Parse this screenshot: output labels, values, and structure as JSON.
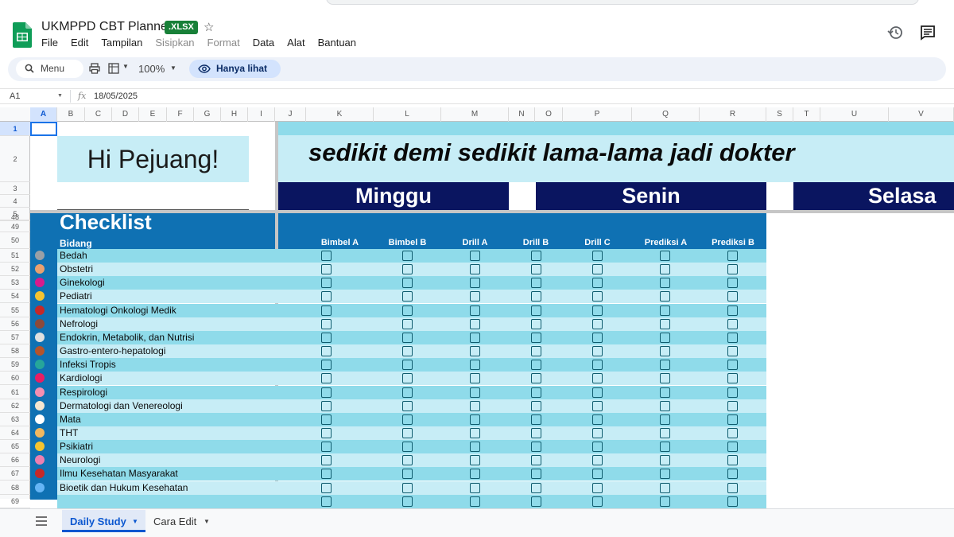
{
  "app": {
    "title": "UKMPPD CBT Planner",
    "badge": ".XLSX",
    "menu": [
      "File",
      "Edit",
      "Tampilan",
      "Sisipkan",
      "Format",
      "Data",
      "Alat",
      "Bantuan"
    ],
    "disabled_menu": [
      "Sisipkan",
      "Format"
    ]
  },
  "toolbar": {
    "search_label": "Menu",
    "zoom": "100%",
    "view_only_label": "Hanya lihat"
  },
  "formula": {
    "cell": "A1",
    "fx": "fx",
    "value": "18/05/2025"
  },
  "columns": [
    "A",
    "B",
    "C",
    "D",
    "E",
    "F",
    "G",
    "H",
    "I",
    "J",
    "K",
    "L",
    "M",
    "N",
    "O",
    "P",
    "Q",
    "R",
    "S",
    "T",
    "U",
    "V"
  ],
  "top_rows": [
    "1",
    "2",
    "3",
    "4",
    "5"
  ],
  "sheet": {
    "greeting": "Hi Pejuang!",
    "motto": "sedikit demi sedikit lama-lama jadi dokter",
    "days": [
      "Minggu",
      "Senin",
      "Selasa"
    ],
    "checklist_title": "Checklist",
    "bidang_label": "Bidang",
    "grid_headers": [
      "Bimbel A",
      "Bimbel B",
      "Drill A",
      "Drill B",
      "Drill C",
      "Prediksi A",
      "Prediksi B"
    ],
    "rows": [
      {
        "num": "51",
        "label": "Bedah",
        "icon": "scalpel-icon",
        "color": "#9aa0a6"
      },
      {
        "num": "52",
        "label": "Obstetri",
        "icon": "pregnant-woman-icon",
        "color": "#e8a070"
      },
      {
        "num": "53",
        "label": "Ginekologi",
        "icon": "female-sign-icon",
        "color": "#d81b8c"
      },
      {
        "num": "54",
        "label": "Pediatri",
        "icon": "baby-icon",
        "color": "#f4c430"
      },
      {
        "num": "55",
        "label": "Hematologi Onkologi Medik",
        "icon": "blood-drop-icon",
        "color": "#c62828"
      },
      {
        "num": "56",
        "label": "Nefrologi",
        "icon": "kidney-icon",
        "color": "#8d4a3a"
      },
      {
        "num": "57",
        "label": "Endokrin, Metabolik, dan Nutrisi",
        "icon": "pill-icon",
        "color": "#e0e0e0"
      },
      {
        "num": "58",
        "label": "Gastro-entero-hepatologi",
        "icon": "stomach-icon",
        "color": "#b5542c"
      },
      {
        "num": "59",
        "label": "Infeksi Tropis",
        "icon": "microbe-icon",
        "color": "#26a69a"
      },
      {
        "num": "60",
        "label": "Kardiologi",
        "icon": "heart-icon",
        "color": "#e91e63"
      },
      {
        "num": "61",
        "label": "Respirologi",
        "icon": "lungs-icon",
        "color": "#f48fb1"
      },
      {
        "num": "62",
        "label": "Dermatologi dan Venereologi",
        "icon": "lotion-icon",
        "color": "#f5e6d0"
      },
      {
        "num": "63",
        "label": "Mata",
        "icon": "eye-icon",
        "color": "#ffffff"
      },
      {
        "num": "64",
        "label": "THT",
        "icon": "ear-icon",
        "color": "#f0b860"
      },
      {
        "num": "65",
        "label": "Psikiatri",
        "icon": "meditation-icon",
        "color": "#f4c430"
      },
      {
        "num": "66",
        "label": "Neurologi",
        "icon": "brain-icon",
        "color": "#ec7fb0"
      },
      {
        "num": "67",
        "label": "Ilmu Kesehatan Masyarakat",
        "icon": "community-icon",
        "color": "#c62828"
      },
      {
        "num": "68",
        "label": "Bioetik dan Hukum Kesehatan",
        "icon": "scales-icon",
        "color": "#64b5f6"
      },
      {
        "num": "69",
        "label": "",
        "icon": "",
        "color": ""
      }
    ],
    "header_rows": [
      "48",
      "49",
      "50"
    ]
  },
  "tabs": [
    {
      "label": "Daily Study",
      "active": true
    },
    {
      "label": "Cara Edit",
      "active": false
    }
  ],
  "colors": {
    "band_light": "#c7edf6",
    "band_dark": "#8fdbea",
    "navy": "#0a1560",
    "blue": "#0f71b3",
    "row_a": "#8fdbea",
    "row_b": "#c7edf6"
  }
}
